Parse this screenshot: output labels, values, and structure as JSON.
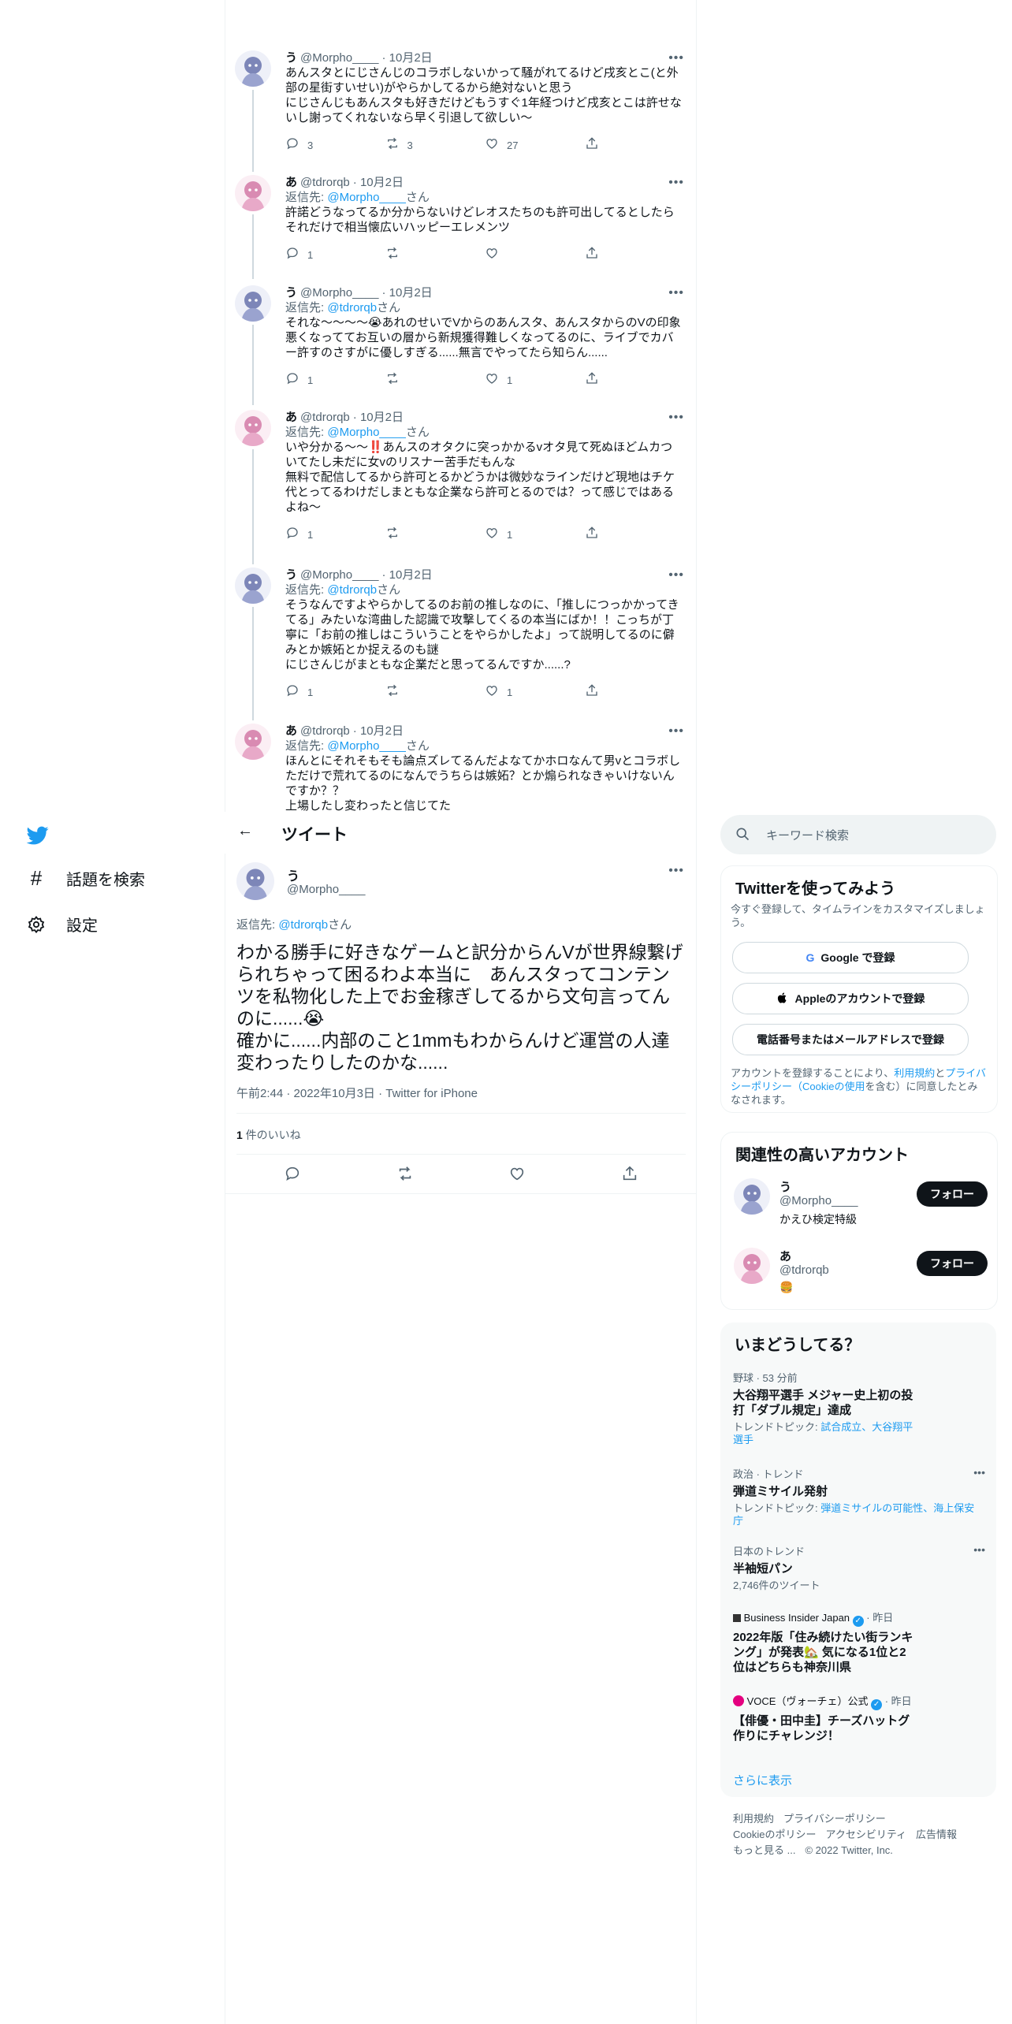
{
  "nav": {
    "items": [
      {
        "label": "話題を検索",
        "icon": "hashtag-icon"
      },
      {
        "label": "設定",
        "icon": "gear-icon"
      }
    ]
  },
  "thread": [
    {
      "name": "う",
      "handle": "@Morpho____",
      "date": "· 10月2日",
      "reply_prefix": "",
      "reply_user": "",
      "reply_suffix": "",
      "text": "あんスタとにじさんじのコラボしないかって騒がれてるけど戌亥とこ(と外部の星街すいせい)がやらかしてるから絶対ないと思う\nにじさんじもあんスタも好きだけどもうすぐ1年経つけど戌亥とこは許せないし謝ってくれないなら早く引退して欲しい〜",
      "replies": "3",
      "retweets": "3",
      "likes": "27",
      "avatar": "blue"
    },
    {
      "name": "あ",
      "handle": "@tdrorqb",
      "date": "· 10月2日",
      "reply_prefix": "返信先: ",
      "reply_user": "@Morpho____",
      "reply_suffix": "さん",
      "text": "許諾どうなってるか分からないけどレオスたちのも許可出してるとしたらそれだけで相当懐広いハッピーエレメンツ",
      "replies": "1",
      "retweets": "",
      "likes": "",
      "avatar": "pink"
    },
    {
      "name": "う",
      "handle": "@Morpho____",
      "date": "· 10月2日",
      "reply_prefix": "返信先: ",
      "reply_user": "@tdrorqb",
      "reply_suffix": "さん",
      "text": "それな〜〜〜〜😭あれのせいでVからのあんスタ、あんスタからのVの印象悪くなっててお互いの層から新規獲得難しくなってるのに、ライブでカバー許すのさすがに優しすぎる......無言でやってたら知らん......",
      "replies": "1",
      "retweets": "",
      "likes": "1",
      "avatar": "blue"
    },
    {
      "name": "あ",
      "handle": "@tdrorqb",
      "date": "· 10月2日",
      "reply_prefix": "返信先: ",
      "reply_user": "@Morpho____",
      "reply_suffix": "さん",
      "text": "いや分かる〜〜‼️あんスのオタクに突っかかるvオタ見て死ぬほどムカついてたし未だに女vのリスナー苦手だもんな\n無料で配信してるから許可とるかどうかは微妙なラインだけど現地はチケ代とってるわけだしまともな企業なら許可とるのでは？って感じではあるよね〜",
      "replies": "1",
      "retweets": "",
      "likes": "1",
      "avatar": "pink"
    },
    {
      "name": "う",
      "handle": "@Morpho____",
      "date": "· 10月2日",
      "reply_prefix": "返信先: ",
      "reply_user": "@tdrorqb",
      "reply_suffix": "さん",
      "text": "そうなんですよやらかしてるのお前の推しなのに、「推しにつっかかってきてる」みたいな湾曲した認識で攻撃してくるの本当にばか！！こっちが丁寧に「お前の推しはこういうことをやらかしたよ」って説明してるのに僻みとか嫉妬とか捉えるのも謎\nにじさんじがまともな企業だと思ってるんですか......?",
      "replies": "1",
      "retweets": "",
      "likes": "1",
      "avatar": "blue"
    },
    {
      "name": "あ",
      "handle": "@tdrorqb",
      "date": "· 10月2日",
      "reply_prefix": "返信先: ",
      "reply_user": "@Morpho____",
      "reply_suffix": "さん",
      "text": "ほんとにそれそもそも論点ズレてるんだよなてかホロなんて男vとコラボしただけで荒れてるのになんでうちらは嫉妬？とか煽られなきゃいけないんですか？？\n上場したし変わったと信じてた",
      "replies": "",
      "retweets": "",
      "likes": "",
      "avatar": "pink"
    }
  ],
  "header": {
    "back": "←",
    "title": "ツイート"
  },
  "main": {
    "name": "う",
    "handle": "@Morpho____",
    "reply_prefix": "返信先: ",
    "reply_user": "@tdrorqb",
    "reply_suffix": "さん",
    "text": "わかる勝手に好きなゲームと訳分からんVが世界線繋げられちゃって困るわよ本当に　あんスタってコンテンツを私物化した上でお金稼ぎしてるから文句言ってんのに......😭\n確かに......内部のこと1mmもわからんけど運営の人達変わったりしたのかな......",
    "date": "午前2:44 · 2022年10月3日 · Twitter for iPhone",
    "like_count": "1",
    "like_label": " 件のいいね"
  },
  "search": {
    "placeholder": "キーワード検索"
  },
  "signup": {
    "title": "Twitterを使ってみよう",
    "subtitle": "今すぐ登録して、タイムラインをカスタマイズしましょう。",
    "google": "Google で登録",
    "apple": "Appleのアカウントで登録",
    "phone": "電話番号またはメールアドレスで登録",
    "terms_a": "アカウントを登録することにより、",
    "terms_link1": "利用規約",
    "terms_b": "と",
    "terms_link2": "プライバシーポリシー（Cookieの使用",
    "terms_c": "を含む）に同意したとみなされます。"
  },
  "related": {
    "title": "関連性の高いアカウント",
    "accounts": [
      {
        "name": "う",
        "handle": "@Morpho____",
        "bio": "かえひ検定特級",
        "button": "フォロー"
      },
      {
        "name": "あ",
        "handle": "@tdrorqb",
        "bio": "🍔",
        "button": "フォロー"
      }
    ]
  },
  "trends": {
    "title": "いまどうしてる？",
    "items": [
      {
        "context": "野球 · 53 分前",
        "title": "大谷翔平選手 メジャー史上初の投打「ダブル規定」達成",
        "sub_label": "トレンドトピック: ",
        "sub_links": "試合成立、大谷翔平選手"
      },
      {
        "context": "政治 · トレンド",
        "title": "弾道ミサイル発射",
        "sub_label": "トレンドトピック: ",
        "sub_links": "弾道ミサイルの可能性、海上保安庁"
      },
      {
        "context": "日本のトレンド",
        "title": "半袖短パン",
        "sub_label": "2,746件のツイート",
        "sub_links": ""
      },
      {
        "context": "Business Insider Japan",
        "context_suffix": "· 昨日",
        "title": "2022年版「住み続けたい街ランキング」が発表🏡 気になる1位と2位はどちらも神奈川県",
        "sub_label": "",
        "sub_links": ""
      },
      {
        "context": "VOCE（ヴォーチェ）公式",
        "context_suffix": "· 昨日",
        "title": "【俳優・田中圭】チーズハットグ作りにチャレンジ！",
        "sub_label": "",
        "sub_links": ""
      }
    ],
    "more": "さらに表示"
  },
  "footer": {
    "links": [
      "利用規約",
      "プライバシーポリシー",
      "Cookieのポリシー",
      "アクセシビリティ",
      "広告情報",
      "もっと見る ..."
    ],
    "copyright": "© 2022 Twitter, Inc."
  },
  "colors": {
    "accent": "#1d9bf0",
    "text": "#0f1419",
    "muted": "#536471",
    "border": "#eff3f4"
  }
}
